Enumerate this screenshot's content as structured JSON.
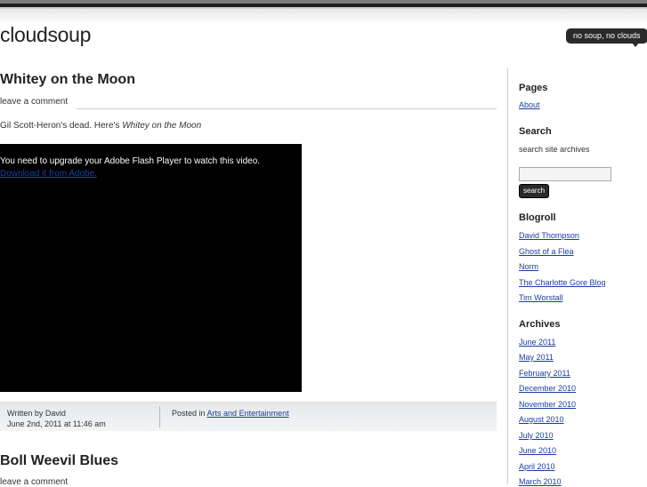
{
  "site": {
    "title": "cloudsoup",
    "tagline": "no soup, no clouds"
  },
  "posts": [
    {
      "title": "Whitey on the Moon",
      "comment_link": "leave a comment",
      "text_prefix": "Gil Scott-Heron's dead. Here's ",
      "text_em": "Whitey on the Moon",
      "video_message": "You need to upgrade your Adobe Flash Player to watch this video.",
      "video_link": "Download it from Adobe.",
      "author": "Written by David",
      "date": "June 2nd, 2011 at 11:46 am",
      "posted_in_label": "Posted in",
      "category": "Arts and Entertainment"
    },
    {
      "title": "Boll Weevil Blues",
      "comment_link": "leave a comment"
    }
  ],
  "sidebar": {
    "pages": {
      "heading": "Pages",
      "items": [
        "About"
      ]
    },
    "search": {
      "heading": "Search",
      "description": "search site archives",
      "input_value": "",
      "button_label": "search"
    },
    "blogroll": {
      "heading": "Blogroll",
      "items": [
        "David Thompson",
        "Ghost of a Flea",
        "Norm",
        "The Charlotte Gore Blog",
        "Tim Worstall"
      ]
    },
    "archives": {
      "heading": "Archives",
      "items": [
        "June 2011",
        "May 2011",
        "February 2011",
        "December 2010",
        "November 2010",
        "August 2010",
        "July 2010",
        "June 2010",
        "April 2010",
        "March 2010"
      ]
    }
  },
  "colors": {
    "link": "#1a3ea0",
    "badge_bg": "#2a2a2a"
  }
}
